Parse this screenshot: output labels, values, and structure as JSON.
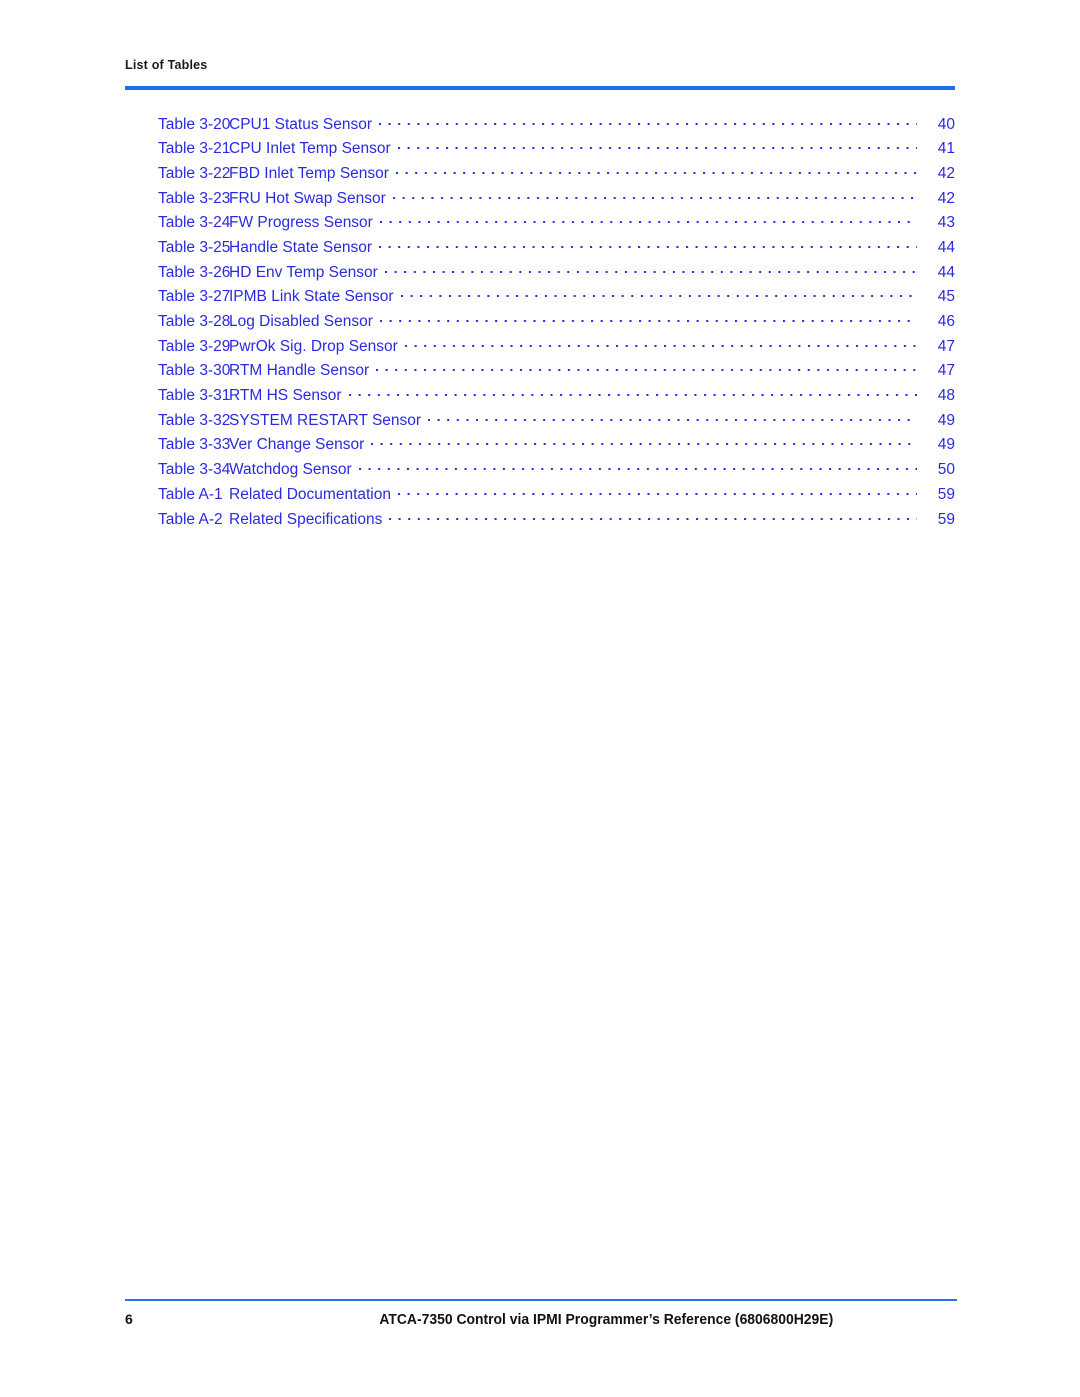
{
  "document": {
    "running_head": "List of Tables",
    "accent_rule_color": "#1a6ee8",
    "link_text_color": "#2a2ae0"
  },
  "toc": {
    "entries": [
      {
        "label": "Table 3-20",
        "title": "CPU1 Status Sensor",
        "page": "40"
      },
      {
        "label": "Table 3-21",
        "title": "CPU Inlet Temp Sensor",
        "page": "41"
      },
      {
        "label": "Table 3-22",
        "title": "FBD Inlet Temp Sensor",
        "page": "42"
      },
      {
        "label": "Table 3-23",
        "title": "FRU Hot Swap Sensor",
        "page": "42"
      },
      {
        "label": "Table 3-24",
        "title": "FW Progress Sensor",
        "page": "43"
      },
      {
        "label": "Table 3-25",
        "title": "Handle State Sensor",
        "page": "44"
      },
      {
        "label": "Table 3-26",
        "title": "HD Env Temp Sensor",
        "page": "44"
      },
      {
        "label": "Table 3-27",
        "title": "IPMB Link State Sensor",
        "page": "45"
      },
      {
        "label": "Table 3-28",
        "title": "Log Disabled Sensor",
        "page": "46"
      },
      {
        "label": "Table 3-29",
        "title": "PwrOk Sig. Drop Sensor",
        "page": "47"
      },
      {
        "label": "Table 3-30",
        "title": "RTM Handle Sensor",
        "page": "47"
      },
      {
        "label": "Table 3-31",
        "title": "RTM HS Sensor",
        "page": "48"
      },
      {
        "label": "Table 3-32",
        "title": "SYSTEM RESTART Sensor",
        "page": "49"
      },
      {
        "label": "Table 3-33",
        "title": "Ver Change Sensor",
        "page": "49"
      },
      {
        "label": "Table 3-34",
        "title": "Watchdog Sensor",
        "page": "50"
      },
      {
        "label": "Table A-1",
        "title": "Related Documentation",
        "page": "59"
      },
      {
        "label": "Table A-2",
        "title": "Related Specifications",
        "page": "59"
      }
    ]
  },
  "footer": {
    "page_number": "6",
    "title": "ATCA-7350 Control via IPMI Programmer’s Reference (6806800H29E)"
  }
}
